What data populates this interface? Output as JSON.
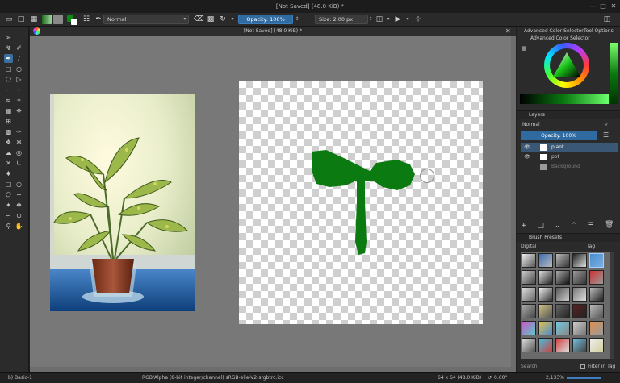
{
  "window": {
    "title": "[Not Saved]  (48.0 KiB) *"
  },
  "toolbar": {
    "blend_mode": "Normal",
    "opacity": "Opacity: 100%",
    "size": "Size: 2.00 px"
  },
  "document": {
    "tab_title": "[Not Saved]  (48.0 KiB) *"
  },
  "dock": {
    "tabs": [
      "Advanced Color Selector",
      "Tool Options"
    ],
    "color_selector_title": "Advanced Color Selector",
    "layers": {
      "title": "Layers",
      "blend_mode": "Normal",
      "opacity": "Opacity:  100%",
      "items": [
        {
          "name": "plant",
          "selected": true
        },
        {
          "name": "pot",
          "selected": false
        },
        {
          "name": "Background",
          "selected": false
        }
      ]
    },
    "brush_presets": {
      "title": "Brush Presets",
      "filter": "Digital",
      "tag": "Tag",
      "search_placeholder": "Search",
      "filter_in_tag": "Filter in Tag"
    }
  },
  "status": {
    "brush": "b) Basic-1",
    "color_model": "RGB/Alpha (8-bit integer/channel)  sRGB-elle-V2-srgbtrc.icc",
    "dimensions": "64 x 64 (48.0 KiB)",
    "rotation": "0.00°",
    "zoom": "2,133%"
  },
  "colors": {
    "accent": "#3d6f9e",
    "plant_green": "#0b7a10",
    "canvas_bg": "#787878"
  }
}
